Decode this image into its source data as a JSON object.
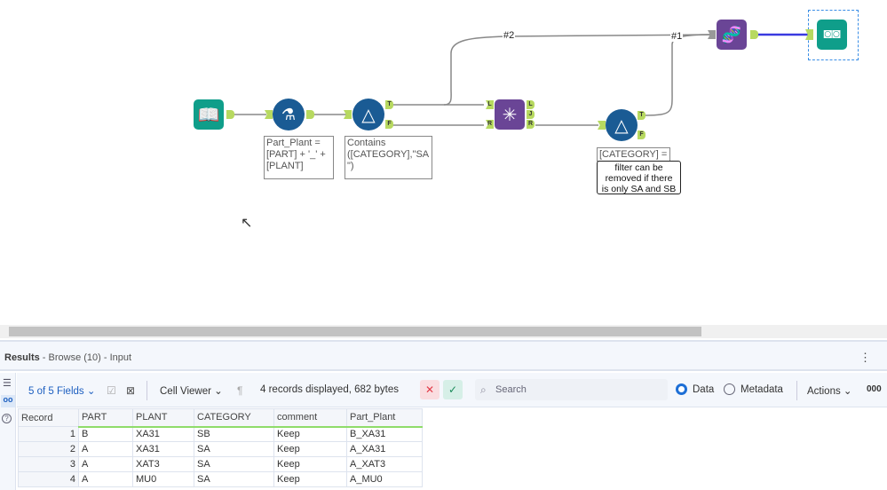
{
  "canvas": {
    "tools": [
      {
        "name": "input-data",
        "icon": "book-icon",
        "color": "#0f9e8a"
      },
      {
        "name": "formula",
        "icon": "flask-icon",
        "color": "#1a5b94"
      },
      {
        "name": "filter",
        "icon": "prism-icon",
        "color": "#1a5b94"
      },
      {
        "name": "join",
        "icon": "join-icon",
        "color": "#6a4596"
      },
      {
        "name": "filter",
        "icon": "prism-icon",
        "color": "#1a5b94"
      },
      {
        "name": "union",
        "icon": "dna-icon",
        "color": "#6a4596"
      },
      {
        "name": "browse",
        "icon": "binoculars-icon",
        "color": "#0f9e8a"
      }
    ],
    "anchors": {
      "t": "T",
      "f": "F",
      "l": "L",
      "j": "J",
      "r": "R"
    },
    "connection_labels": {
      "c2": "#2",
      "c1": "#1"
    },
    "annotations": {
      "formula": [
        "Part_Plant =",
        "[PART] + '_' +",
        "[PLANT]"
      ],
      "filter1": [
        "Contains",
        "([CATEGORY],\"SA",
        "\")"
      ],
      "filter2": "[CATEGORY] =",
      "comment": [
        "filter can be",
        "removed if there",
        "is only SA and SB"
      ]
    }
  },
  "results": {
    "title": "Results",
    "subtitle": " - Browse (10) - Input"
  },
  "toolbar": {
    "fields": "5 of 5 Fields",
    "cell_viewer": "Cell Viewer",
    "status": "4 records displayed, 682 bytes",
    "search_placeholder": "Search",
    "data": "Data",
    "metadata": "Metadata",
    "actions": "Actions",
    "more": "000",
    "selected_view": "Data"
  },
  "table": {
    "columns": [
      "Record",
      "PART",
      "PLANT",
      "CATEGORY",
      "comment",
      "Part_Plant"
    ],
    "rows": [
      [
        "1",
        "B",
        "XA31",
        "SB",
        "Keep",
        "B_XA31"
      ],
      [
        "2",
        "A",
        "XA31",
        "SA",
        "Keep",
        "A_XA31"
      ],
      [
        "3",
        "A",
        "XAT3",
        "SA",
        "Keep",
        "A_XAT3"
      ],
      [
        "4",
        "A",
        "MU0",
        "SA",
        "Keep",
        "A_MU0"
      ]
    ]
  }
}
